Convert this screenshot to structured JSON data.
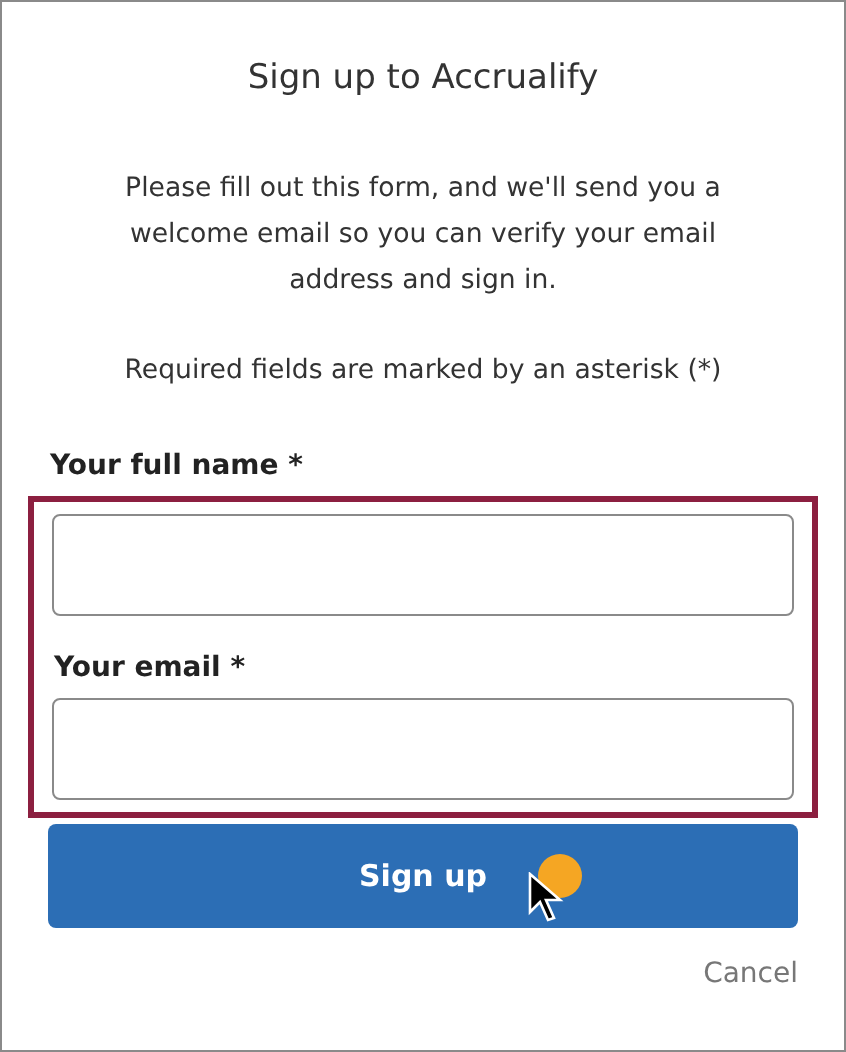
{
  "title": "Sign up to Accrualify",
  "intro": "Please fill out this form, and we'll send you a welcome email so you can verify your email address and sign in.",
  "required_note": "Required fields are marked by an asterisk (*)",
  "fields": [
    {
      "label": "Your full name *"
    },
    {
      "label": "Your email *"
    }
  ],
  "highlight_frame_shown": true,
  "submit_button": {
    "label": "Sign up",
    "clicked": true
  },
  "cancel_link": "Cancel"
}
